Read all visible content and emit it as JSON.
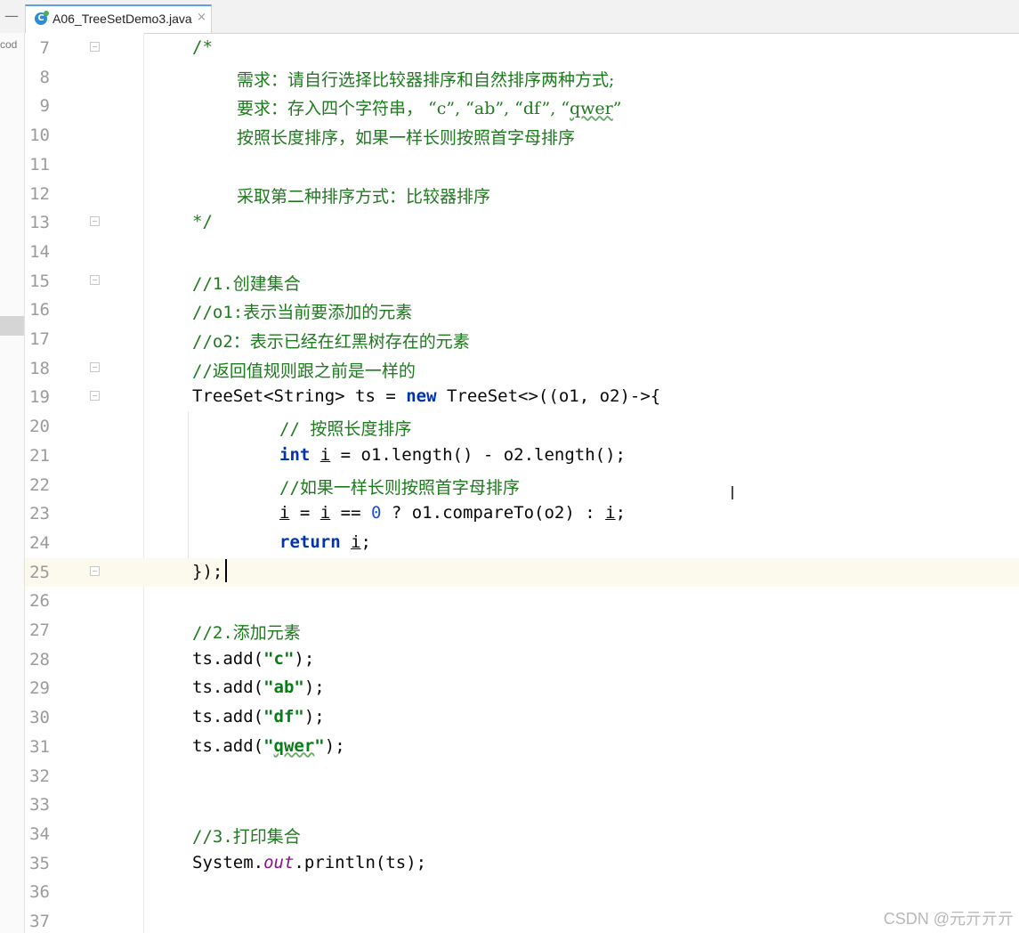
{
  "tab": {
    "icon": "class-c-icon",
    "title": "A06_TreeSetDemo3.java",
    "close": "×",
    "minimize": "—"
  },
  "side_panel": {
    "text": "cod"
  },
  "lines": [
    {
      "n": "7",
      "fold": true
    },
    {
      "n": "8"
    },
    {
      "n": "9"
    },
    {
      "n": "10"
    },
    {
      "n": "11"
    },
    {
      "n": "12"
    },
    {
      "n": "13",
      "fold": true
    },
    {
      "n": "14"
    },
    {
      "n": "15",
      "fold": true
    },
    {
      "n": "16"
    },
    {
      "n": "17"
    },
    {
      "n": "18",
      "fold": true
    },
    {
      "n": "19",
      "fold": true
    },
    {
      "n": "20"
    },
    {
      "n": "21"
    },
    {
      "n": "22"
    },
    {
      "n": "23"
    },
    {
      "n": "24"
    },
    {
      "n": "25",
      "fold": true,
      "current": true
    },
    {
      "n": "26"
    },
    {
      "n": "27"
    },
    {
      "n": "28"
    },
    {
      "n": "29"
    },
    {
      "n": "30"
    },
    {
      "n": "31"
    },
    {
      "n": "32"
    },
    {
      "n": "33"
    },
    {
      "n": "34"
    },
    {
      "n": "35"
    },
    {
      "n": "36"
    },
    {
      "n": "37"
    }
  ],
  "code": {
    "l7": "/*",
    "l8": "需求：请自行选择比较器排序和自然排序两种方式;",
    "l9a": "要求：存入四个字符串， “c”, “ab”, “df”, “",
    "l9b": "qwer",
    "l9c": "”",
    "l10": "按照长度排序，如果一样长则按照首字母排序",
    "l12": "采取第二种排序方式：比较器排序",
    "l13": "*/",
    "l15": "//1.创建集合",
    "l16": "//o1:表示当前要添加的元素",
    "l17": "//o2：表示已经在红黑树存在的元素",
    "l18": "//返回值规则跟之前是一样的",
    "l19a": "TreeSet<String> ts = ",
    "l19kw": "new",
    "l19b": " TreeSet<>((o1, o2)->{",
    "l20": "// 按照长度排序",
    "l21kw": "int",
    "l21sp": " ",
    "l21var": "i",
    "l21b": " = o1.length() - o2.length();",
    "l22": "//如果一样长则按照首字母排序",
    "l23var1": "i",
    "l23a": " = ",
    "l23var2": "i",
    "l23b": " == ",
    "l23num": "0",
    "l23c": " ? o1.compareTo(o2) : ",
    "l23var3": "i",
    "l23d": ";",
    "l24kw": "return",
    "l24sp": " ",
    "l24var": "i",
    "l24b": ";",
    "l25": "});",
    "l27": "//2.添加元素",
    "l28a": "ts.add(",
    "l28s": "\"c\"",
    "l28b": ");",
    "l29a": "ts.add(",
    "l29s": "\"ab\"",
    "l29b": ");",
    "l30a": "ts.add(",
    "l30s": "\"df\"",
    "l30b": ");",
    "l31a": "ts.add(",
    "l31s1": "\"",
    "l31s2": "qwer",
    "l31s3": "\"",
    "l31b": ");",
    "l34": "//3.打印集合",
    "l35a": "System.",
    "l35f": "out",
    "l35b": ".println(ts);"
  },
  "watermark": "CSDN @元亓亓亓"
}
